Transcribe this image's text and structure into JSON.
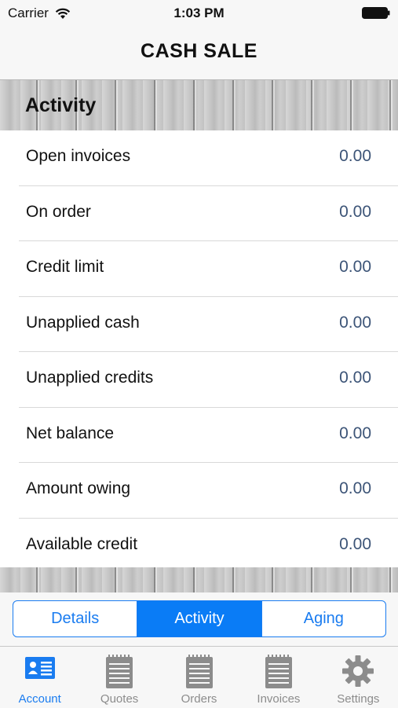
{
  "status_bar": {
    "carrier": "Carrier",
    "time": "1:03 PM"
  },
  "nav": {
    "title": "CASH SALE"
  },
  "section": {
    "title": "Activity"
  },
  "rows": [
    {
      "label": "Open invoices",
      "value": "0.00"
    },
    {
      "label": "On order",
      "value": "0.00"
    },
    {
      "label": "Credit limit",
      "value": "0.00"
    },
    {
      "label": "Unapplied cash",
      "value": "0.00"
    },
    {
      "label": "Unapplied credits",
      "value": "0.00"
    },
    {
      "label": "Net balance",
      "value": "0.00"
    },
    {
      "label": "Amount owing",
      "value": "0.00"
    },
    {
      "label": "Available credit",
      "value": "0.00"
    }
  ],
  "segments": [
    {
      "label": "Details",
      "selected": false
    },
    {
      "label": "Activity",
      "selected": true
    },
    {
      "label": "Aging",
      "selected": false
    }
  ],
  "tabs": [
    {
      "label": "Account",
      "icon": "account-card-icon",
      "selected": true
    },
    {
      "label": "Quotes",
      "icon": "notepad-icon",
      "selected": false
    },
    {
      "label": "Orders",
      "icon": "notepad-icon",
      "selected": false
    },
    {
      "label": "Invoices",
      "icon": "notepad-icon",
      "selected": false
    },
    {
      "label": "Settings",
      "icon": "gear-icon",
      "selected": false
    }
  ],
  "colors": {
    "accent": "#1a7cf0",
    "value_text": "#3c5477",
    "inactive_tab": "#8c8c8c"
  }
}
